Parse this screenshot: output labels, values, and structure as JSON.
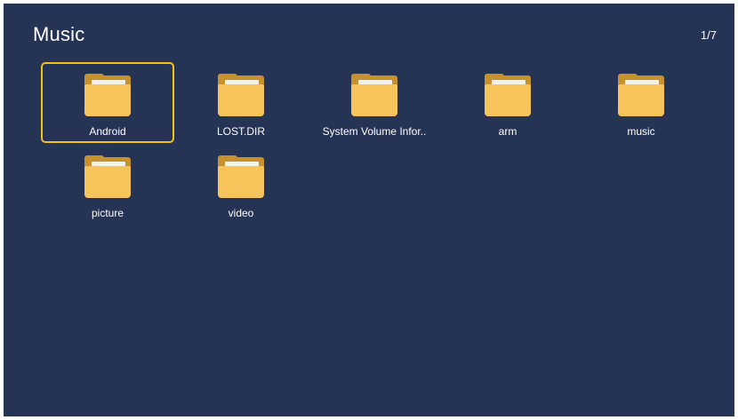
{
  "header": {
    "title": "Music",
    "page_indicator": "1/7"
  },
  "colors": {
    "background": "#253354",
    "selection_border": "#f2c21b",
    "folder_front": "#f6c45a",
    "folder_back": "#c6912e"
  },
  "folders": [
    {
      "label": "Android",
      "icon": "folder-icon",
      "selected": true
    },
    {
      "label": "LOST.DIR",
      "icon": "folder-icon",
      "selected": false
    },
    {
      "label": "System Volume Infor..",
      "icon": "folder-icon",
      "selected": false
    },
    {
      "label": "arm",
      "icon": "folder-icon",
      "selected": false
    },
    {
      "label": "music",
      "icon": "folder-icon",
      "selected": false
    },
    {
      "label": "picture",
      "icon": "folder-icon",
      "selected": false
    },
    {
      "label": "video",
      "icon": "folder-icon",
      "selected": false
    }
  ]
}
